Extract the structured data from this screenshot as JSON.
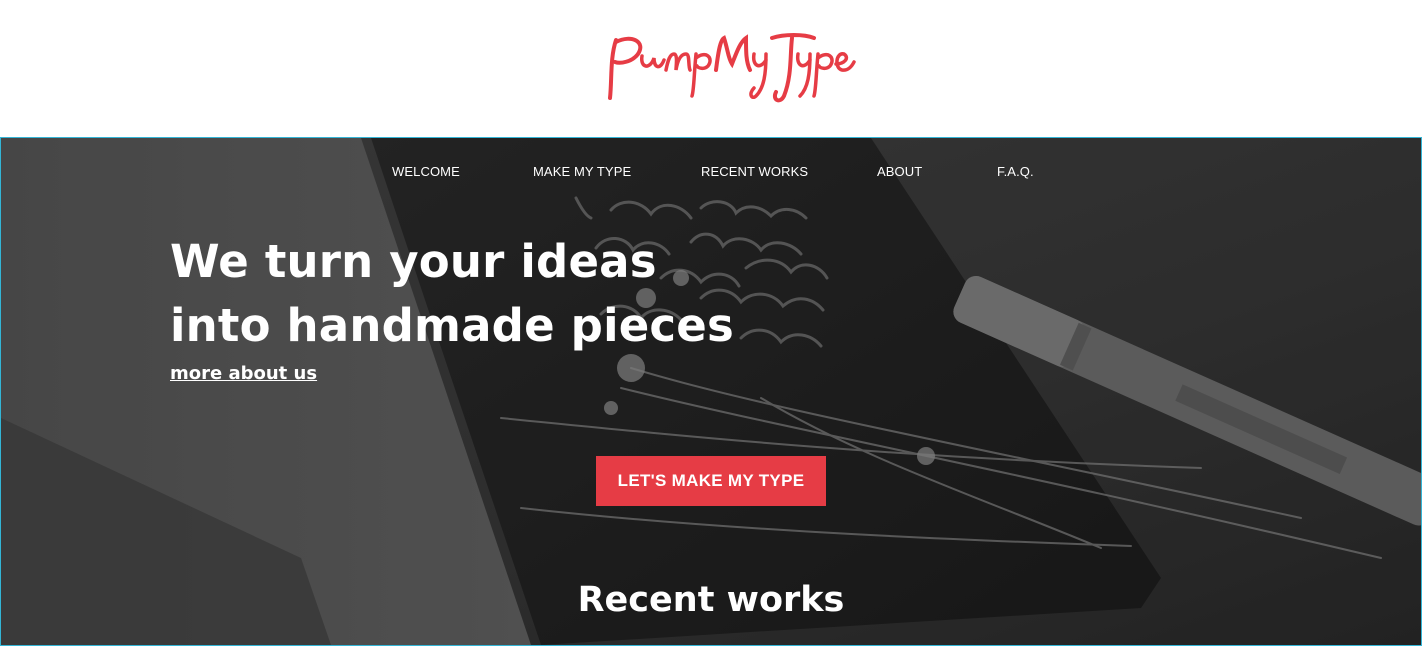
{
  "brand": {
    "logo_text": "PumpMyType",
    "logo_color": "#e63c45"
  },
  "nav": {
    "items": [
      {
        "label": "WELCOME"
      },
      {
        "label": "MAKE MY TYPE"
      },
      {
        "label": "RECENT WORKS"
      },
      {
        "label": "ABOUT"
      },
      {
        "label": "F.A.Q."
      }
    ]
  },
  "hero": {
    "headline_line1": "We turn your ideas",
    "headline_line2": "into handmade pieces",
    "more_link": "more about us",
    "cta_label": "LET'S MAKE MY TYPE",
    "cta_color": "#e63c45",
    "section_title": "Recent works",
    "background": "black-and-white photo of an open notebook with handwritten lettering, dried flowers and a pen"
  },
  "colors": {
    "accent": "#e63c45",
    "hero_border": "#33b5d6"
  }
}
